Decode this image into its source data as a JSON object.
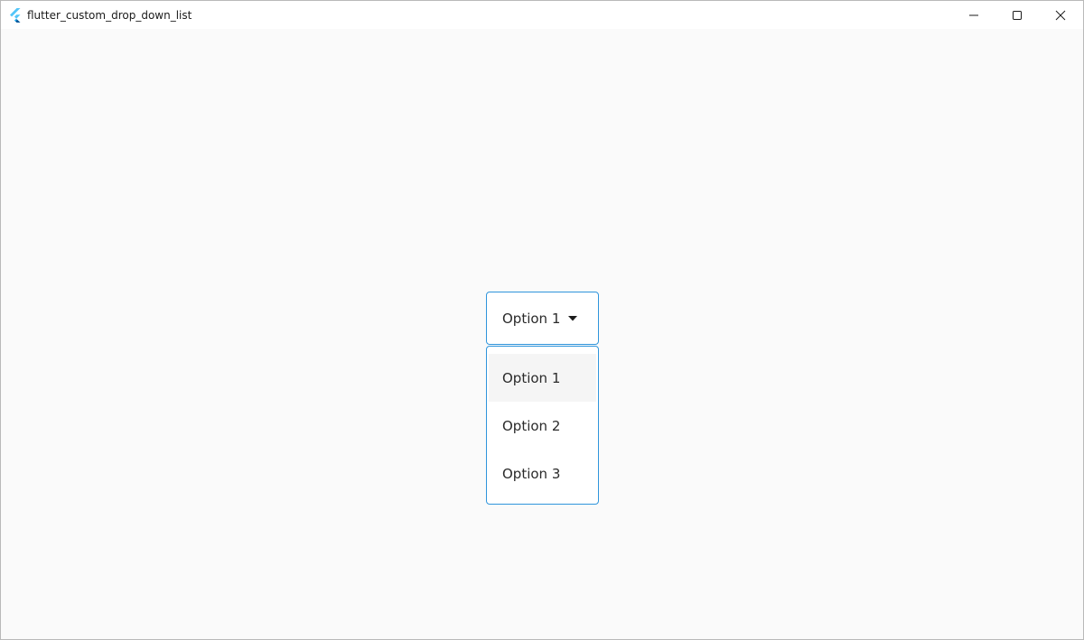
{
  "window": {
    "title": "flutter_custom_drop_down_list",
    "controls": [
      "minimize-icon",
      "maximize-icon",
      "close-icon"
    ]
  },
  "dropdown": {
    "selected_label": "Option 1",
    "caret_icon": "caret-down-icon",
    "options": [
      {
        "label": "Option 1",
        "selected": true
      },
      {
        "label": "Option 2",
        "selected": false
      },
      {
        "label": "Option 3",
        "selected": false
      }
    ]
  },
  "colors": {
    "border_accent": "#2f95dc",
    "background": "#fafafa",
    "selected_item": "#f5f5f5",
    "flutter_light": "#54c5f8",
    "flutter_dark": "#01579b"
  }
}
